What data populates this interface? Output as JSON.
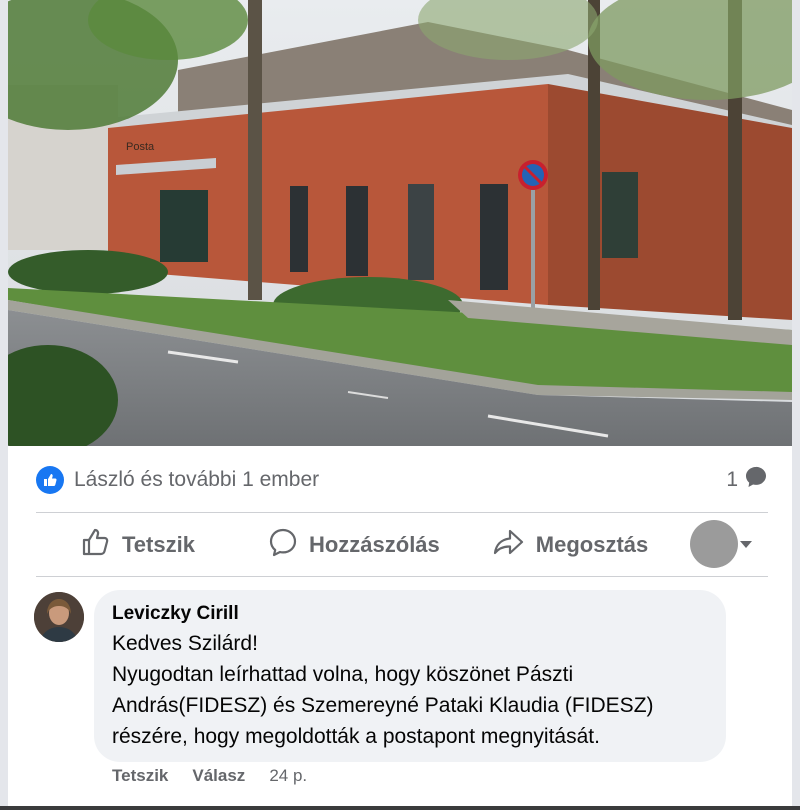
{
  "photo": {
    "alt_icon": "post-photo",
    "building_sign": "Posta"
  },
  "reactions": {
    "icon": "like-badge-icon",
    "text": "László és további 1 ember",
    "comment_count": "1",
    "comment_icon": "comment-bubble-icon"
  },
  "actions": {
    "like_label": "Tetszik",
    "comment_label": "Hozzászólás",
    "share_label": "Megosztás"
  },
  "comment": {
    "author": "Leviczky Cirill",
    "lines": [
      "Kedves Szilárd!",
      "Nyugodtan leírhattad volna, hogy köszönet Pászti",
      "András(FIDESZ) és Szemereyné Pataki Klaudia (FIDESZ)",
      "részére, hogy megoldották a postapont megnyitását."
    ],
    "like_label": "Tetszik",
    "reply_label": "Válasz",
    "time": "24 p."
  },
  "colors": {
    "brand_blue": "#1877f2",
    "secondary_text": "#65676b",
    "bubble_bg": "#f0f2f5"
  }
}
